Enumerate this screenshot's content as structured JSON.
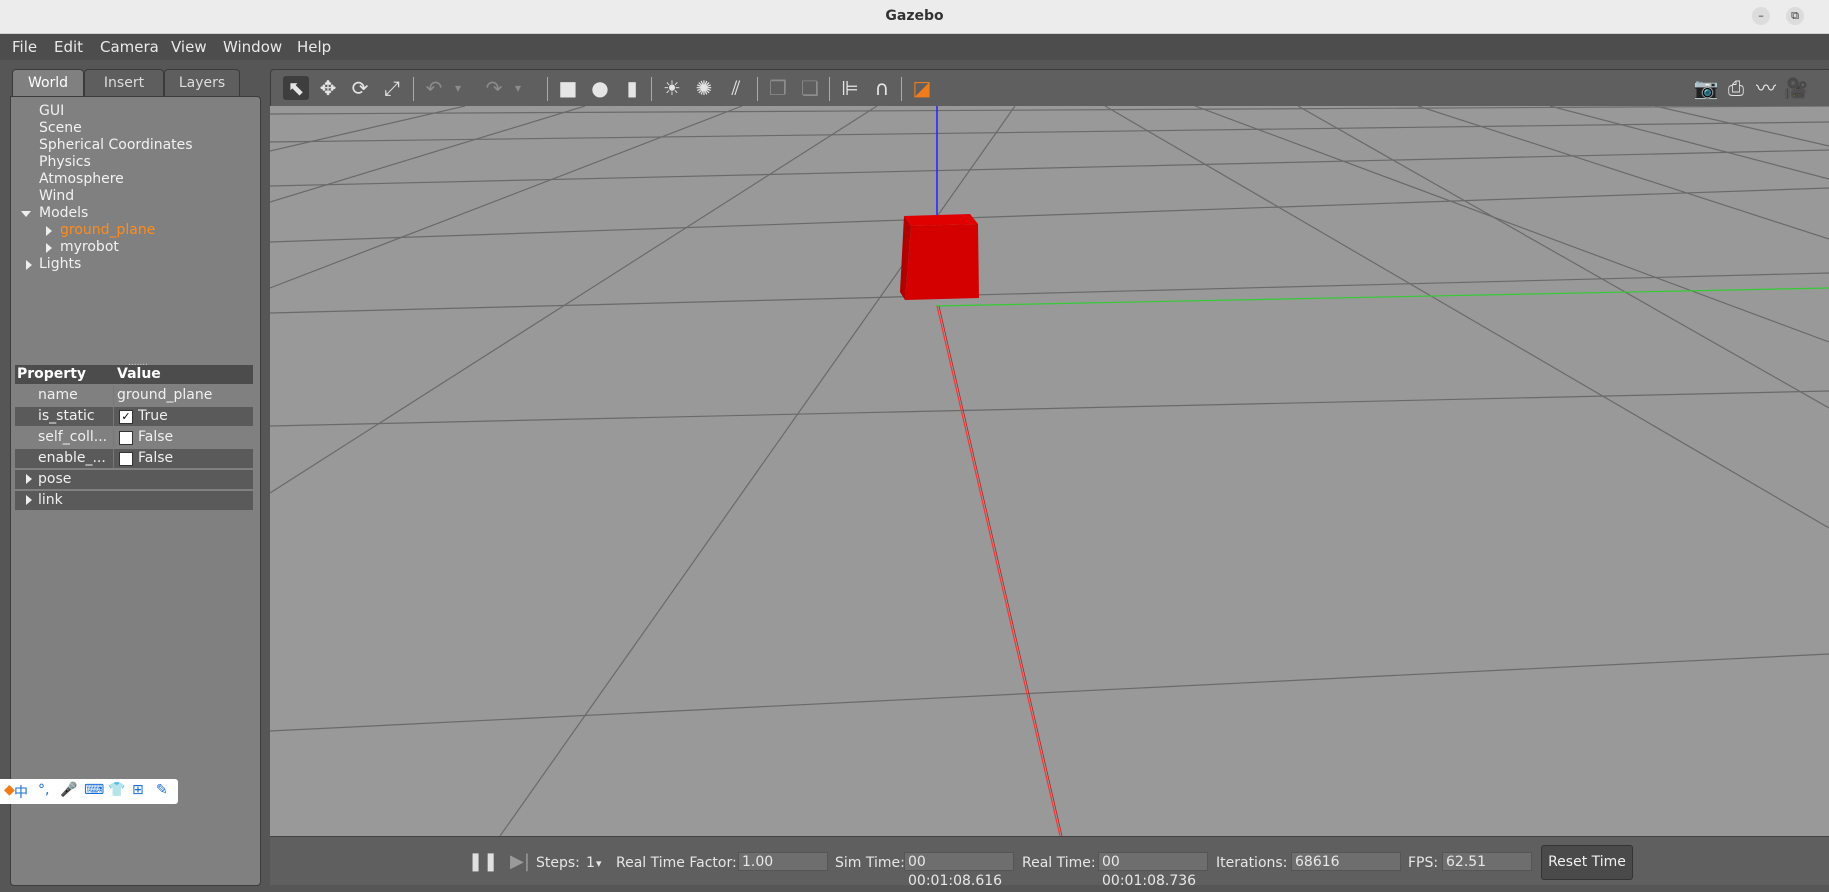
{
  "window": {
    "title": "Gazebo",
    "minimize": "–",
    "maximize": "⧉"
  },
  "menu": [
    "File",
    "Edit",
    "Camera",
    "View",
    "Window",
    "Help"
  ],
  "left_tabs": [
    "World",
    "Insert",
    "Layers"
  ],
  "tree": {
    "items": [
      "GUI",
      "Scene",
      "Spherical Coordinates",
      "Physics",
      "Atmosphere",
      "Wind"
    ],
    "models_label": "Models",
    "models": [
      "ground_plane",
      "myrobot"
    ],
    "lights_label": "Lights"
  },
  "properties": {
    "header": {
      "property": "Property",
      "value": "Value"
    },
    "rows": [
      {
        "name": "name",
        "value": "ground_plane"
      },
      {
        "name": "is_static",
        "value": "True",
        "checked": "✓"
      },
      {
        "name": "self_coll...",
        "value": "False"
      },
      {
        "name": "enable_...",
        "value": "False"
      },
      {
        "name": "pose"
      },
      {
        "name": "link"
      }
    ]
  },
  "ime": [
    "中",
    "°,",
    "🎤",
    "⌨",
    "👕",
    "⊞",
    "✎"
  ],
  "toolbar": {
    "select": "⬉",
    "translate": "✥",
    "rotate": "⟳",
    "scale": "⤢",
    "undo": "↶",
    "redo": "↷",
    "dropdown": "▾",
    "box": "■",
    "sphere": "●",
    "cylinder": "▮",
    "point_light": "☀",
    "spot_light": "✺",
    "directional_light": "⫽",
    "copy": "❐",
    "paste": "❏",
    "align": "⊫",
    "snap": "∩",
    "view_angle": "◪",
    "screenshot": "📷",
    "log": "⎙",
    "plot": "〰",
    "record": "🎥"
  },
  "bottom": {
    "pause_icon": "❚❚",
    "step_icon": "▶|",
    "steps_label": "Steps:",
    "steps_value": "1",
    "steps_arrow": "▾",
    "rtf_label": "Real Time Factor:",
    "rtf_value": "1.00",
    "sim_time_label": "Sim Time:",
    "sim_time_value": "00 00:01:08.616",
    "real_time_label": "Real Time:",
    "real_time_value": "00 00:01:08.736",
    "iterations_label": "Iterations:",
    "iterations_value": "68616",
    "fps_label": "FPS:",
    "fps_value": "62.51",
    "reset_label": "Reset Time"
  },
  "colors": {
    "selected_tree": "#ff8c1a",
    "box": "#d60000",
    "axis_x": "#ff3333",
    "axis_y": "#33cc33",
    "axis_z": "#2222ff",
    "viewport_bg": "#999999"
  }
}
